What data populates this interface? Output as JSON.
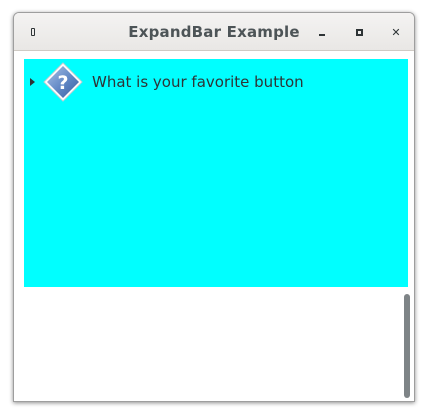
{
  "window": {
    "title": "ExpandBar Example"
  },
  "expand_bar": {
    "background": "#00ffff",
    "item": {
      "label": "What is your favorite button",
      "icon": "question-icon",
      "expanded": true
    }
  }
}
